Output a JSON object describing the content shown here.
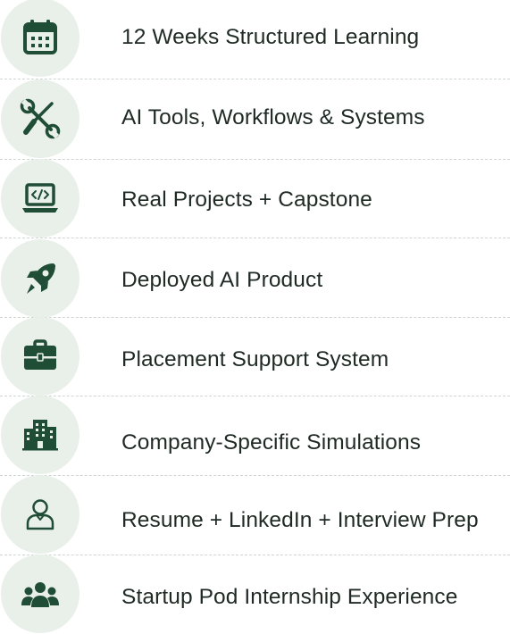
{
  "theme": {
    "icon_color": "#1f4d36",
    "icon_bg": "#e9efe9",
    "text_color": "#1f2a24",
    "divider_color": "#cfd5d1"
  },
  "features": {
    "items": [
      {
        "label": "12 Weeks Structured Learning",
        "icon": "calendar-icon"
      },
      {
        "label": "AI Tools, Workflows & Systems",
        "icon": "tools-icon"
      },
      {
        "label": "Real Projects + Capstone",
        "icon": "laptop-code-icon"
      },
      {
        "label": "Deployed AI Product",
        "icon": "rocket-icon"
      },
      {
        "label": "Placement Support System",
        "icon": "briefcase-icon"
      },
      {
        "label": "Company-Specific Simulations",
        "icon": "buildings-icon"
      },
      {
        "label": "Resume + LinkedIn + Interview Prep",
        "icon": "user-profile-icon"
      },
      {
        "label": "Startup Pod Internship Experience",
        "icon": "team-icon"
      }
    ]
  }
}
